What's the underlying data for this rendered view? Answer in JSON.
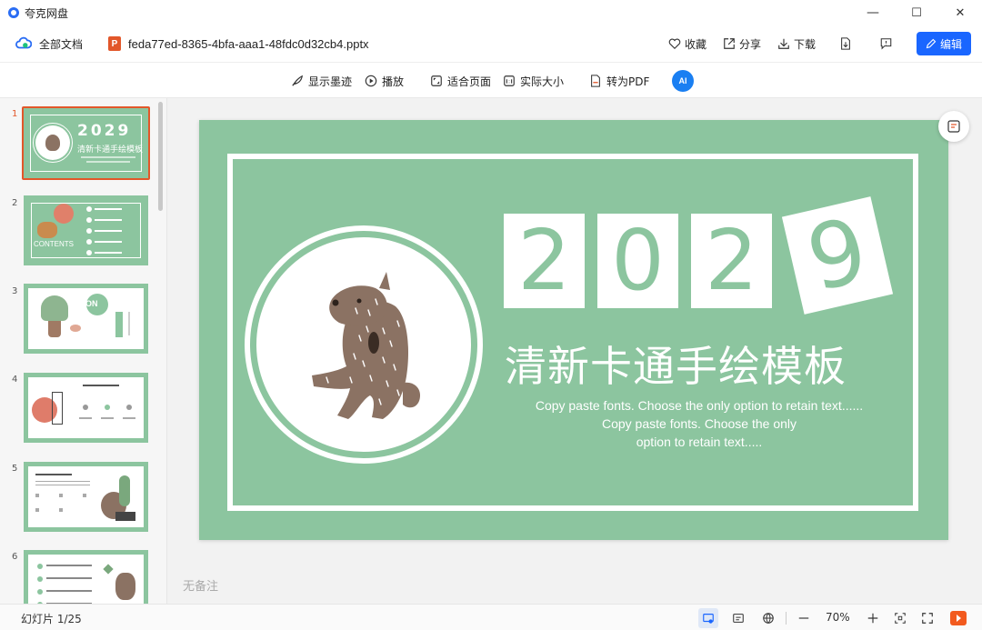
{
  "app": {
    "title": "夸克网盘"
  },
  "window": {
    "minimize": "—",
    "maximize": "☐",
    "close": "✕"
  },
  "header": {
    "all_docs": "全部文档",
    "filename": "feda77ed-8365-4bfa-aaa1-48fdc0d32cb4.pptx",
    "file_type_badge": "P",
    "favorite": "收藏",
    "share": "分享",
    "download": "下载",
    "edit": "编辑"
  },
  "toolbar": {
    "show_ink": "显示墨迹",
    "play": "播放",
    "fit_page": "适合页面",
    "actual_size": "实际大小",
    "to_pdf": "转为PDF",
    "ai": "AI"
  },
  "sidebar": {
    "slides": [
      {
        "num": "1",
        "active": true
      },
      {
        "num": "2"
      },
      {
        "num": "3"
      },
      {
        "num": "4"
      },
      {
        "num": "5"
      },
      {
        "num": "6"
      }
    ],
    "thumb1": {
      "digits": "2029",
      "title": "清新卡通手绘模板"
    },
    "thumb2": {
      "label": "CONTENTS"
    },
    "thumb3": {
      "label": "ON"
    }
  },
  "slide": {
    "digits": [
      "2",
      "0",
      "2",
      "9"
    ],
    "title": "清新卡通手绘模板",
    "subtitle_lines": [
      "Copy paste fonts. Choose the only option to retain text......",
      "Copy paste fonts. Choose the only",
      "option to retain text....."
    ],
    "bg_color": "#8cc59f",
    "bear_color": "#8b7263"
  },
  "notes": {
    "placeholder": "无备注"
  },
  "status": {
    "slide_counter": "幻灯片 1/25",
    "zoom": "70%"
  },
  "colors": {
    "accent": "#1a66ff",
    "active_slide": "#e2572a",
    "play_icon": "#f25a1e"
  }
}
